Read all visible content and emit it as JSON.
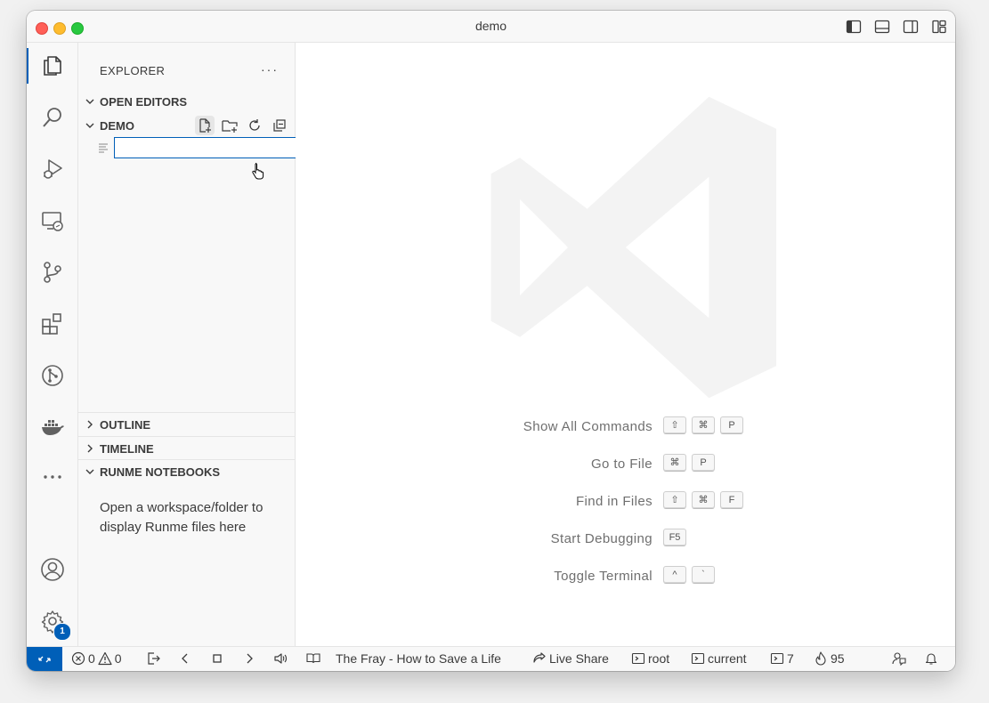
{
  "window": {
    "title": "demo"
  },
  "sidebar": {
    "title": "EXPLORER",
    "more": "···",
    "sections": {
      "open_editors": "OPEN EDITORS",
      "demo": "DEMO",
      "outline": "OUTLINE",
      "timeline": "TIMELINE",
      "runme": "RUNME NOTEBOOKS"
    },
    "new_file_input": {
      "value": "",
      "placeholder": ""
    },
    "runme_message": "Open a workspace/folder to display Runme files here"
  },
  "activity_bar": {
    "icons": [
      "files-icon",
      "search-icon",
      "run-debug-icon",
      "remote-explorer-icon",
      "source-control-icon",
      "extensions-icon",
      "git-graph-icon",
      "docker-icon",
      "more-icon",
      "account-icon",
      "settings-icon"
    ],
    "settings_badge": "1"
  },
  "editor": {
    "shortcuts": [
      {
        "label": "Show All Commands",
        "keys": [
          "⇧",
          "⌘",
          "P"
        ]
      },
      {
        "label": "Go to File",
        "keys": [
          "⌘",
          "P"
        ]
      },
      {
        "label": "Find in Files",
        "keys": [
          "⇧",
          "⌘",
          "F"
        ]
      },
      {
        "label": "Start Debugging",
        "keys": [
          "F5"
        ]
      },
      {
        "label": "Toggle Terminal",
        "keys": [
          "^",
          "`"
        ]
      }
    ]
  },
  "statusbar": {
    "errors": "0",
    "warnings": "0",
    "track": "The Fray - How to Save a Life",
    "live_share": "Live Share",
    "term_root": "root",
    "term_current": "current",
    "term_count": "7",
    "flame_count": "95"
  },
  "colors": {
    "accent": "#005fb8",
    "background": "#ffffff",
    "sidebar": "#f8f8f8",
    "border": "#e5e5e5"
  }
}
